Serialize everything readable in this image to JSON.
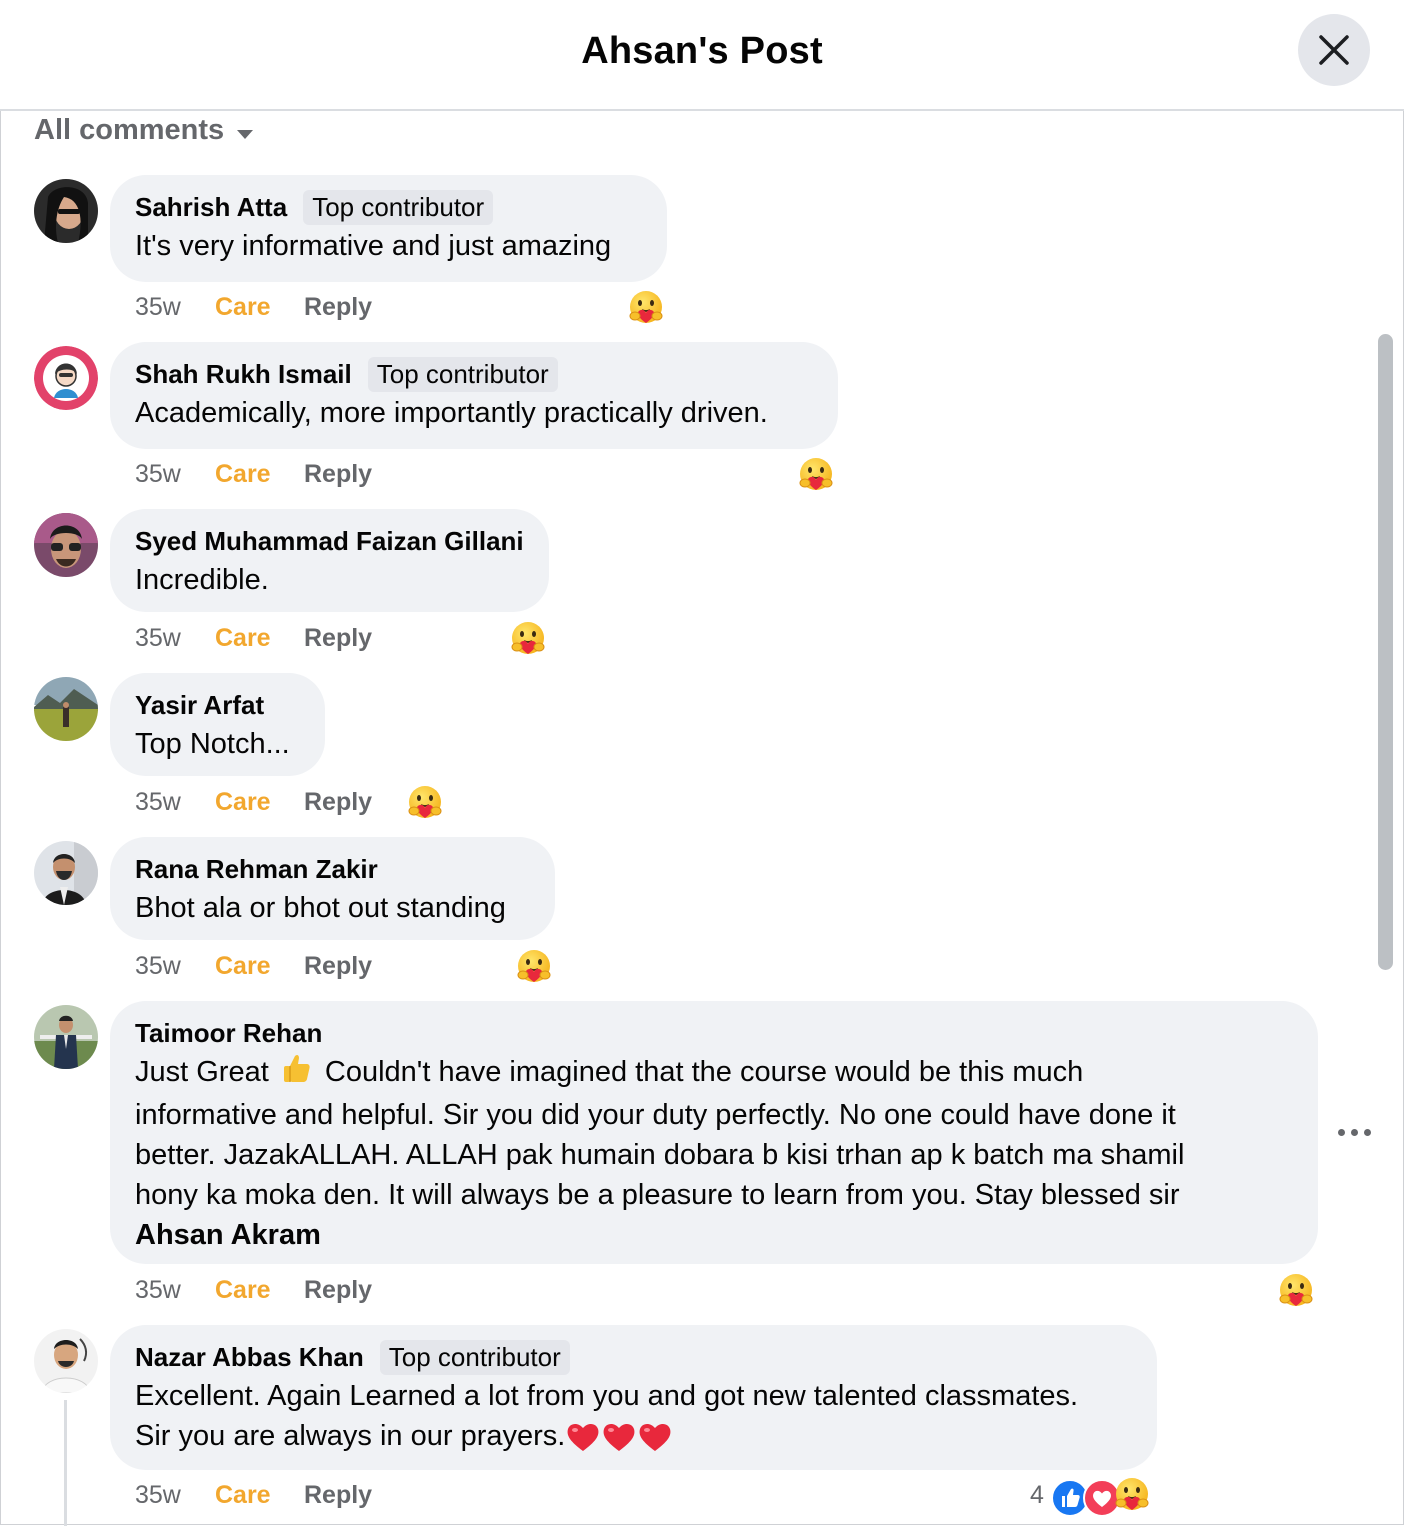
{
  "header": {
    "title": "Ahsan's Post"
  },
  "filter": {
    "label": "All comments"
  },
  "comments": [
    {
      "name": "Sahrish Atta",
      "badge": "Top contributor",
      "text": "It's very informative and just amazing",
      "time": "35w",
      "reaction_label": "Care",
      "reply_label": "Reply",
      "reaction": "care-emoji"
    },
    {
      "name": "Shah Rukh Ismail",
      "badge": "Top contributor",
      "text": "Academically, more importantly practically driven.",
      "time": "35w",
      "reaction_label": "Care",
      "reply_label": "Reply",
      "reaction": "care-emoji"
    },
    {
      "name": "Syed Muhammad Faizan Gillani",
      "text": "Incredible.",
      "time": "35w",
      "reaction_label": "Care",
      "reply_label": "Reply",
      "reaction": "care-emoji"
    },
    {
      "name": "Yasir Arfat",
      "text": "Top Notch...",
      "time": "35w",
      "reaction_label": "Care",
      "reply_label": "Reply",
      "reaction": "care-emoji"
    },
    {
      "name": "Rana Rehman Zakir",
      "text": "Bhot ala or bhot out standing",
      "time": "35w",
      "reaction_label": "Care",
      "reply_label": "Reply",
      "reaction": "care-emoji"
    },
    {
      "name": "Taimoor Rehan",
      "lines": [
        "Just Great",
        "Couldn't have imagined that the course would be this much",
        "informative and helpful. Sir you did your duty perfectly. No one could have done it",
        "better. JazakALLAH. ALLAH pak humain dobara b kisi trhan ap k batch ma shamil",
        "hony ka moka den. It will always be a pleasure to learn from you. Stay blessed sir"
      ],
      "mention": "Ahsan Akram",
      "time": "35w",
      "reaction_label": "Care",
      "reply_label": "Reply",
      "reaction": "care-emoji"
    },
    {
      "name": "Nazar Abbas Khan",
      "badge": "Top contributor",
      "lines": [
        "Excellent. Again Learned a lot from you and got new talented classmates.",
        "Sir you are always in our prayers."
      ],
      "time": "35w",
      "reaction_label": "Care",
      "reply_label": "Reply",
      "reaction_count": "4",
      "reactions": [
        "like-icon",
        "love-icon",
        "care-emoji"
      ]
    }
  ]
}
